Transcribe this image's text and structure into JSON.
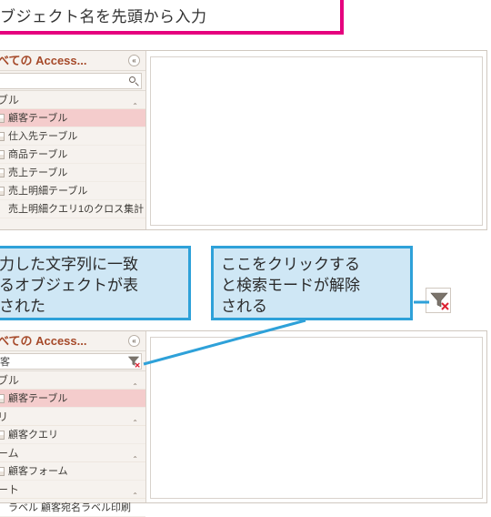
{
  "colors": {
    "pink": "#e5007e",
    "blue": "#2ea1d9",
    "blue_fill": "#cfe7f5",
    "accent_text": "#a64a2a"
  },
  "pink_callout": "ブジェクト名を先頭から入力",
  "blue_callout_left": "力した文字列に一致\nるオブジェクトが表\nされた",
  "blue_callout_right": "ここをクリックする\nと検索モードが解除\nされる",
  "nav_header": "べての Access...",
  "search_placeholder_top": "",
  "search_value_bottom": "客",
  "panel_top_group": "ブル",
  "panel_top_items": [
    {
      "label": "顧客テーブル",
      "selected": true
    },
    {
      "label": "仕入先テーブル"
    },
    {
      "label": "商品テーブル"
    },
    {
      "label": "売上テーブル"
    },
    {
      "label": "売上明細テーブル"
    },
    {
      "label": "売上明細クエリ1のクロス集計",
      "no_icon": true
    }
  ],
  "panel_bottom": [
    {
      "head": "ブル",
      "items": [
        {
          "label": "顧客テーブル",
          "selected": true
        }
      ]
    },
    {
      "head": "リ",
      "items": [
        {
          "label": "顧客クエリ"
        }
      ]
    },
    {
      "head": "ーム",
      "items": [
        {
          "label": "顧客フォーム"
        }
      ]
    },
    {
      "head": "ート",
      "items": [
        {
          "label": "ラベル 顧客宛名ラベル印刷",
          "no_icon": true
        }
      ]
    }
  ],
  "icons": {
    "search": "search-icon",
    "chevron": "chevron-double-icon",
    "collapse": "chevron-up-icon",
    "filter_clear": "filter-clear-icon"
  }
}
